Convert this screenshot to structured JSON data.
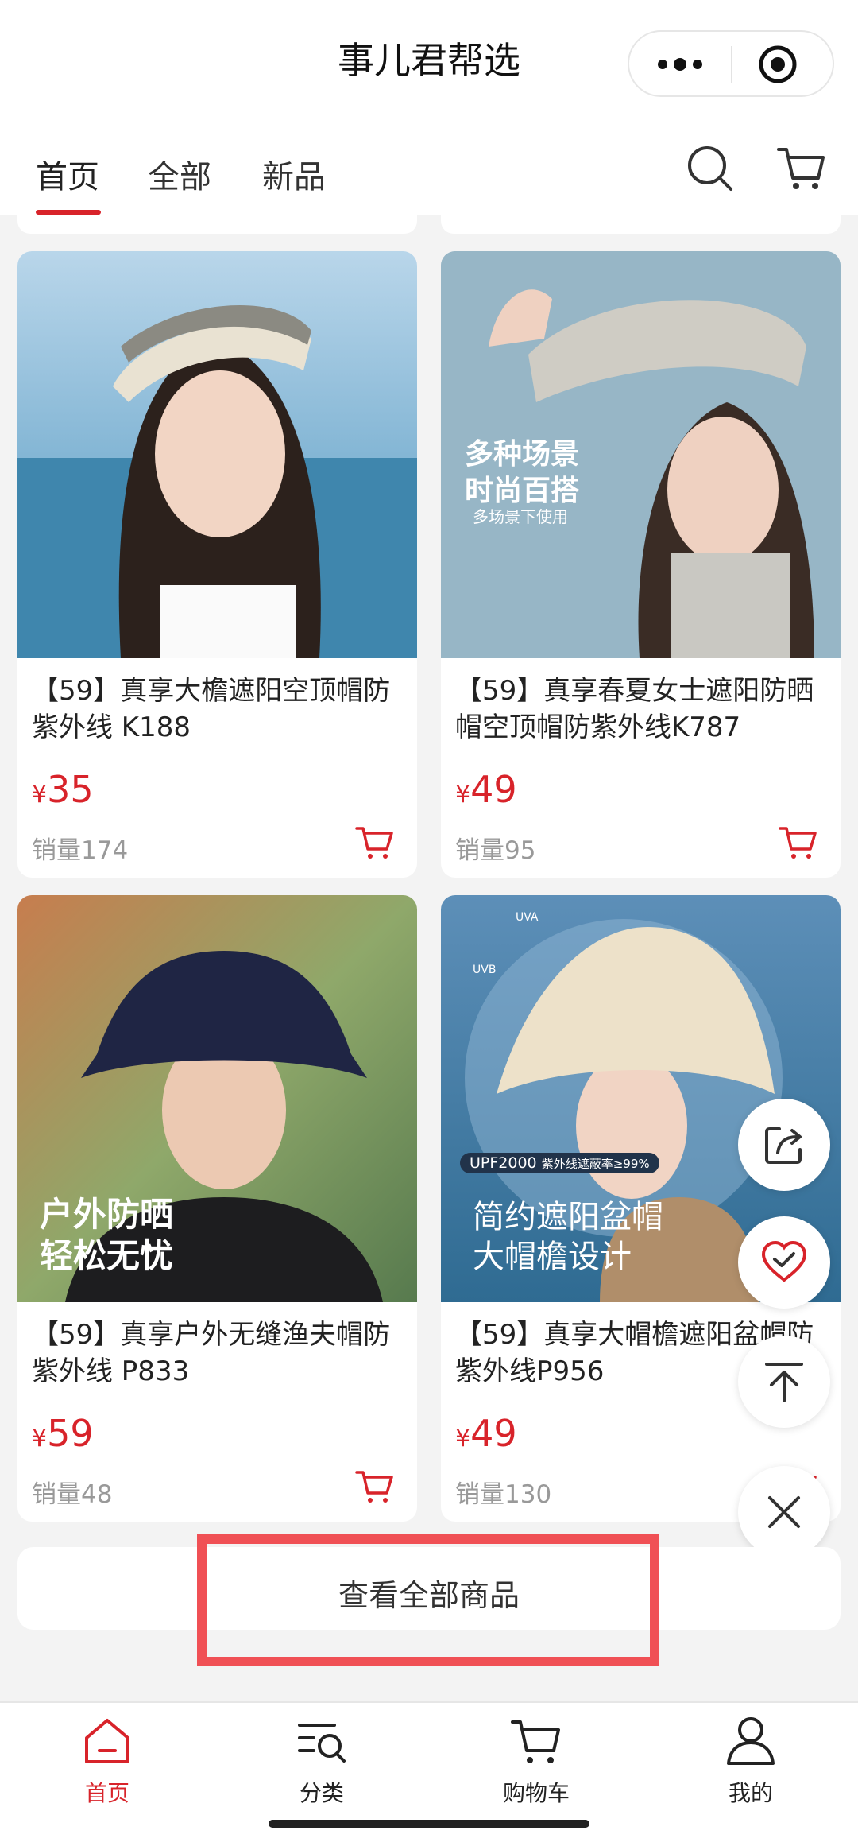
{
  "header": {
    "title": "事儿君帮选"
  },
  "tabs": [
    {
      "label": "首页",
      "active": true
    },
    {
      "label": "全部"
    },
    {
      "label": "新品"
    }
  ],
  "products": [
    {
      "title": "【59】真享大檐遮阳空顶帽防紫外线 K188",
      "currency": "¥",
      "price": "35",
      "sales": "销量174"
    },
    {
      "title": "【59】真享春夏女士遮阳防晒帽空顶帽防紫外线K787",
      "currency": "¥",
      "price": "49",
      "sales": "销量95",
      "overlay": {
        "line1": "多种场景",
        "line2": "时尚百搭",
        "line3": "多场景下使用"
      }
    },
    {
      "title": "【59】真享户外无缝渔夫帽防紫外线 P833",
      "currency": "¥",
      "price": "59",
      "sales": "销量48",
      "overlay": {
        "line1": "户外防晒",
        "line2": "轻松无忧"
      }
    },
    {
      "title": "【59】真享大帽檐遮阳盆帽防紫外线P956",
      "currency": "¥",
      "price": "49",
      "sales": "销量130",
      "overlay": {
        "badge": "UPF2000",
        "badge2": "紫外线遮蔽率≥99%",
        "line1": "简约遮阳盆帽",
        "line2": "大帽檐设计",
        "uva": "UVA",
        "uvb": "UVB"
      }
    }
  ],
  "view_all": {
    "label": "查看全部商品"
  },
  "bottom_nav": [
    {
      "label": "首页",
      "active": true
    },
    {
      "label": "分类"
    },
    {
      "label": "购物车"
    },
    {
      "label": "我的"
    }
  ],
  "colors": {
    "accent": "#d8232a",
    "highlight_box": "#f05055",
    "background": "#f3f3f3"
  }
}
